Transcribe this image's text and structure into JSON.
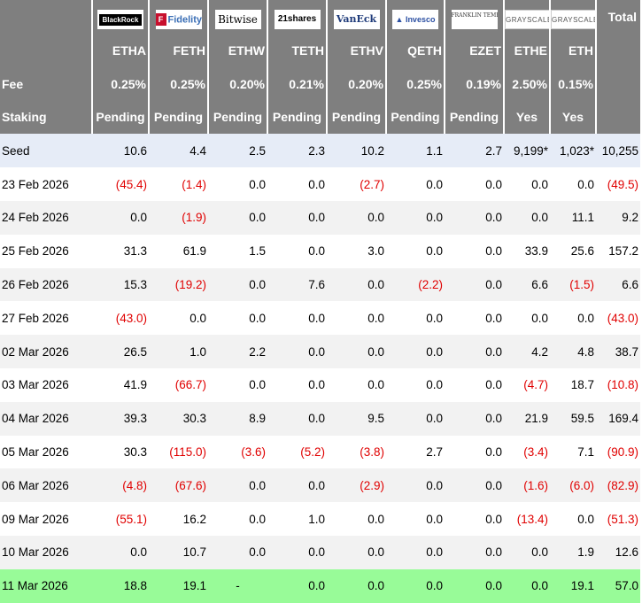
{
  "header": {
    "total_label": "Total",
    "logos": [
      {
        "icon": "blackrock-logo",
        "text": "BlackRock"
      },
      {
        "icon": "fidelity-logo",
        "text": "Fidelity"
      },
      {
        "icon": "bitwise-logo",
        "text": "Bitwise"
      },
      {
        "icon": "21shares-logo",
        "text": "21shares"
      },
      {
        "icon": "vaneck-logo",
        "text": "VanEck"
      },
      {
        "icon": "invesco-logo",
        "text": "Invesco"
      },
      {
        "icon": "franklin-templeton-logo",
        "text": "FRANKLIN TEMPLETON"
      },
      {
        "icon": "grayscale-logo",
        "text": "GRAYSCALE"
      },
      {
        "icon": "grayscale-logo",
        "text": "GRAYSCALE"
      }
    ],
    "tickers": [
      "ETHA",
      "FETH",
      "ETHW",
      "TETH",
      "ETHV",
      "QETH",
      "EZET",
      "ETHE",
      "ETH"
    ]
  },
  "fee": {
    "label": "Fee",
    "values": [
      "0.25%",
      "0.25%",
      "0.20%",
      "0.21%",
      "0.20%",
      "0.25%",
      "0.19%",
      "2.50%",
      "0.15%"
    ]
  },
  "staking": {
    "label": "Staking",
    "values": [
      "Pending",
      "Pending",
      "Pending",
      "Pending",
      "Pending",
      "Pending",
      "Pending",
      "Yes",
      "Yes"
    ]
  },
  "rows": [
    {
      "label": "Seed",
      "values": [
        "10.6",
        "4.4",
        "2.5",
        "2.3",
        "10.2",
        "1.1",
        "2.7",
        "9,199*",
        "1,023*",
        "10,255"
      ],
      "neg": [
        false,
        false,
        false,
        false,
        false,
        false,
        false,
        false,
        false,
        false
      ]
    },
    {
      "label": "23 Feb 2026",
      "values": [
        "(45.4)",
        "(1.4)",
        "0.0",
        "0.0",
        "(2.7)",
        "0.0",
        "0.0",
        "0.0",
        "0.0",
        "(49.5)"
      ],
      "neg": [
        true,
        true,
        false,
        false,
        true,
        false,
        false,
        false,
        false,
        true
      ]
    },
    {
      "label": "24 Feb 2026",
      "values": [
        "0.0",
        "(1.9)",
        "0.0",
        "0.0",
        "0.0",
        "0.0",
        "0.0",
        "0.0",
        "11.1",
        "9.2"
      ],
      "neg": [
        false,
        true,
        false,
        false,
        false,
        false,
        false,
        false,
        false,
        false
      ]
    },
    {
      "label": "25 Feb 2026",
      "values": [
        "31.3",
        "61.9",
        "1.5",
        "0.0",
        "3.0",
        "0.0",
        "0.0",
        "33.9",
        "25.6",
        "157.2"
      ],
      "neg": [
        false,
        false,
        false,
        false,
        false,
        false,
        false,
        false,
        false,
        false
      ]
    },
    {
      "label": "26 Feb 2026",
      "values": [
        "15.3",
        "(19.2)",
        "0.0",
        "7.6",
        "0.0",
        "(2.2)",
        "0.0",
        "6.6",
        "(1.5)",
        "6.6"
      ],
      "neg": [
        false,
        true,
        false,
        false,
        false,
        true,
        false,
        false,
        true,
        false
      ]
    },
    {
      "label": "27 Feb 2026",
      "values": [
        "(43.0)",
        "0.0",
        "0.0",
        "0.0",
        "0.0",
        "0.0",
        "0.0",
        "0.0",
        "0.0",
        "(43.0)"
      ],
      "neg": [
        true,
        false,
        false,
        false,
        false,
        false,
        false,
        false,
        false,
        true
      ]
    },
    {
      "label": "02 Mar 2026",
      "values": [
        "26.5",
        "1.0",
        "2.2",
        "0.0",
        "0.0",
        "0.0",
        "0.0",
        "4.2",
        "4.8",
        "38.7"
      ],
      "neg": [
        false,
        false,
        false,
        false,
        false,
        false,
        false,
        false,
        false,
        false
      ]
    },
    {
      "label": "03 Mar 2026",
      "values": [
        "41.9",
        "(66.7)",
        "0.0",
        "0.0",
        "0.0",
        "0.0",
        "0.0",
        "(4.7)",
        "18.7",
        "(10.8)"
      ],
      "neg": [
        false,
        true,
        false,
        false,
        false,
        false,
        false,
        true,
        false,
        true
      ]
    },
    {
      "label": "04 Mar 2026",
      "values": [
        "39.3",
        "30.3",
        "8.9",
        "0.0",
        "9.5",
        "0.0",
        "0.0",
        "21.9",
        "59.5",
        "169.4"
      ],
      "neg": [
        false,
        false,
        false,
        false,
        false,
        false,
        false,
        false,
        false,
        false
      ]
    },
    {
      "label": "05 Mar 2026",
      "values": [
        "30.3",
        "(115.0)",
        "(3.6)",
        "(5.2)",
        "(3.8)",
        "2.7",
        "0.0",
        "(3.4)",
        "7.1",
        "(90.9)"
      ],
      "neg": [
        false,
        true,
        true,
        true,
        true,
        false,
        false,
        true,
        false,
        true
      ]
    },
    {
      "label": "06 Mar 2026",
      "values": [
        "(4.8)",
        "(67.6)",
        "0.0",
        "0.0",
        "(2.9)",
        "0.0",
        "0.0",
        "(1.6)",
        "(6.0)",
        "(82.9)"
      ],
      "neg": [
        true,
        true,
        false,
        false,
        true,
        false,
        false,
        true,
        true,
        true
      ]
    },
    {
      "label": "09 Mar 2026",
      "values": [
        "(55.1)",
        "16.2",
        "0.0",
        "1.0",
        "0.0",
        "0.0",
        "0.0",
        "(13.4)",
        "0.0",
        "(51.3)"
      ],
      "neg": [
        true,
        false,
        false,
        false,
        false,
        false,
        false,
        true,
        false,
        true
      ]
    },
    {
      "label": "10 Mar 2026",
      "values": [
        "0.0",
        "10.7",
        "0.0",
        "0.0",
        "0.0",
        "0.0",
        "0.0",
        "0.0",
        "1.9",
        "12.6"
      ],
      "neg": [
        false,
        false,
        false,
        false,
        false,
        false,
        false,
        false,
        false,
        false
      ]
    },
    {
      "label": "11 Mar 2026",
      "values": [
        "18.8",
        "19.1",
        "-",
        "0.0",
        "0.0",
        "0.0",
        "0.0",
        "0.0",
        "19.1",
        "57.0"
      ],
      "neg": [
        false,
        false,
        false,
        false,
        false,
        false,
        false,
        false,
        false,
        false
      ]
    }
  ],
  "colors": {
    "header_bg": "#7f7f7f",
    "seed_bg": "#e6ecf7",
    "alt_bg": "#f2f2f2",
    "last_bg": "#98fb98",
    "negative": "#e00000"
  }
}
